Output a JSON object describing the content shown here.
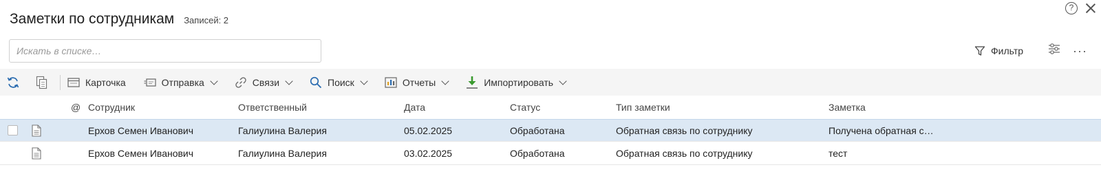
{
  "window": {
    "help_icon": "?"
  },
  "header": {
    "title": "Заметки по сотрудникам",
    "records": "Записей: 2"
  },
  "search": {
    "placeholder": "Искать в списке…",
    "value": ""
  },
  "tools": {
    "filter_label": "Фильтр",
    "more_label": "···"
  },
  "toolbar": {
    "card": "Карточка",
    "send": "Отправка",
    "links": "Связи",
    "search": "Поиск",
    "reports": "Отчеты",
    "import": "Импортировать"
  },
  "columns": {
    "at": "@",
    "employee": "Сотрудник",
    "responsible": "Ответственный",
    "date": "Дата",
    "status": "Статус",
    "note_type": "Тип заметки",
    "note": "Заметка"
  },
  "rows": [
    {
      "employee": "Ерхов Семен Иванович",
      "responsible": "Галиулина Валерия",
      "date": "05.02.2025",
      "status": "Обработана",
      "note_type": "Обратная связь по сотруднику",
      "note": "Получена обратная с…",
      "selected": true
    },
    {
      "employee": "Ерхов Семен Иванович",
      "responsible": "Галиулина Валерия",
      "date": "03.02.2025",
      "status": "Обработана",
      "note_type": "Обратная связь по сотруднику",
      "note": "тест",
      "selected": false
    }
  ],
  "colors": {
    "accent": "#2b6cb0",
    "selected_row": "#dce8f4",
    "toolbar_bg": "#f5f5f5",
    "import_green": "#3a9a2f"
  }
}
